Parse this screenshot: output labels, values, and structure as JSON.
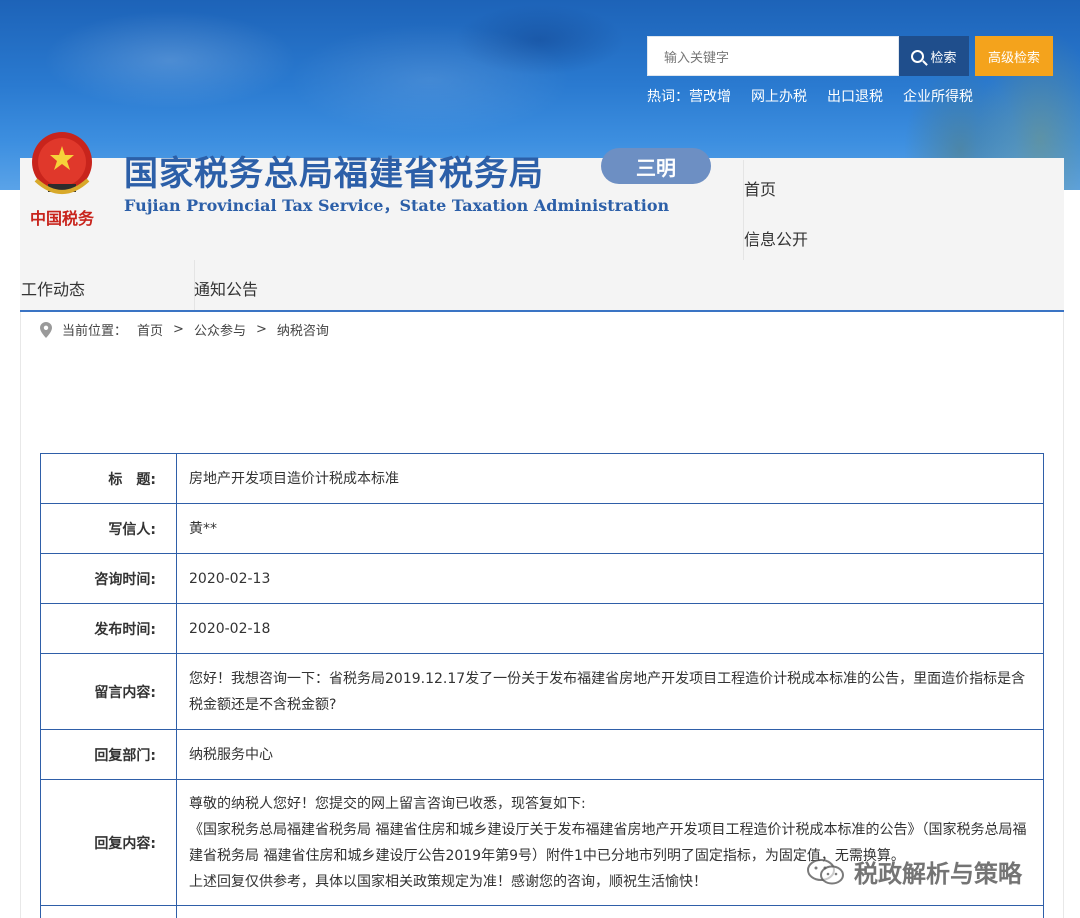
{
  "search": {
    "placeholder": "输入关键字",
    "search_label": "检索",
    "advanced_label": "高级检索"
  },
  "hotwords": {
    "prefix": "热词：",
    "items": [
      "营改增",
      "网上办税",
      "出口退税",
      "企业所得税"
    ]
  },
  "site": {
    "title": "国家税务总局福建省税务局",
    "subtitle": "Fujian Provincial Tax Service，State Taxation Administration",
    "city": "三明",
    "emblem_text": "中国税务"
  },
  "nav": {
    "home": "首页",
    "info": "信息公开",
    "work": "工作动态",
    "notice": "通知公告"
  },
  "breadcrumb": {
    "prefix": "当前位置：",
    "items": [
      "首页",
      "公众参与",
      "纳税咨询"
    ],
    "separator": ">"
  },
  "record": {
    "rows": [
      {
        "label": "标　题:",
        "value": "房地产开发项目造价计税成本标准"
      },
      {
        "label": "写信人:",
        "value": "黄**"
      },
      {
        "label": "咨询时间:",
        "value": "2020-02-13"
      },
      {
        "label": "发布时间:",
        "value": "2020-02-18"
      },
      {
        "label": "留言内容:",
        "value": "您好！我想咨询一下：省税务局2019.12.17发了一份关于发布福建省房地产开发项目工程造价计税成本标准的公告，里面造价指标是含税金额还是不含税金额?"
      },
      {
        "label": "回复部门:",
        "value": "纳税服务中心"
      }
    ],
    "reply_label": "回复内容:",
    "reply_lines": [
      "尊敬的纳税人您好！您提交的网上留言咨询已收悉，现答复如下:",
      "《国家税务总局福建省税务局 福建省住房和城乡建设厅关于发布福建省房地产开发项目工程造价计税成本标准的公告》（国家税务总局福建省税务局 福建省住房和城乡建设厅公告2019年第9号）附件1中已分地市列明了固定指标，为固定值，无需换算。",
      "上述回复仅供参考，具体以国家相关政策规定为准！感谢您的咨询，顺祝生活愉快！"
    ]
  },
  "watermark": "税政解析与策略",
  "colors": {
    "banner_blue": "#1d63b8",
    "brand_blue": "#2c5fa8",
    "search_button": "#1f4e8c",
    "advanced_button": "#f4a31c",
    "table_border": "#2f5fa8"
  }
}
